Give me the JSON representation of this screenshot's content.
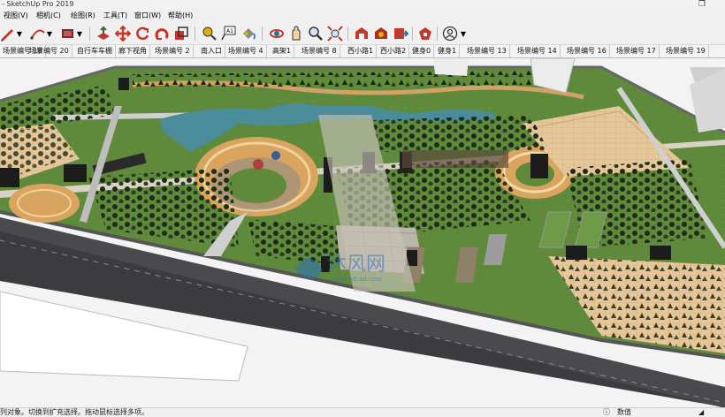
{
  "app": {
    "title": "- SketchUp Pro 2019"
  },
  "menu": {
    "view": "视图(V)",
    "camera": "相机(C)",
    "draw": "绘图(R)",
    "tools": "工具(T)",
    "window": "窗口(W)",
    "help": "帮助(H)"
  },
  "toolbar": {
    "icons": [
      "pencil-icon",
      "arc-icon",
      "shapes-icon",
      "pushpull-icon",
      "move-icon",
      "rotate-icon",
      "scale-icon",
      "tape-measure-icon",
      "text-icon",
      "paint-bucket-icon",
      "orbit-icon",
      "pan-icon",
      "zoom-icon",
      "zoom-extents-icon",
      "warehouse-icon",
      "extension-warehouse-icon",
      "layout-icon",
      "extension-icon",
      "user-account-icon"
    ]
  },
  "scenes": [
    "场景编号 18",
    "场景编号 20",
    "自行车车棚",
    "廊下视角",
    "场景编号 2",
    "南入口",
    "场景编号 4",
    "高架1",
    "场景编号 8",
    "西小路1",
    "西小路2",
    "健身0",
    "健身1",
    "场景编号 13",
    "场景编号 14",
    "场景编号 16",
    "场景编号 17",
    "场景编号 19"
  ],
  "watermark": {
    "text": "沐风网",
    "url": "www.mfcad.com"
  },
  "status": {
    "left": "列对象。切换到扩充选择。拖动鼠标选择多项。",
    "right": "数值"
  },
  "colors": {
    "grass": "#5f8a3c",
    "paving": "#e8c99a",
    "road": "#3c3c40",
    "water": "#4a8c9a",
    "accent": "#d2a165"
  }
}
